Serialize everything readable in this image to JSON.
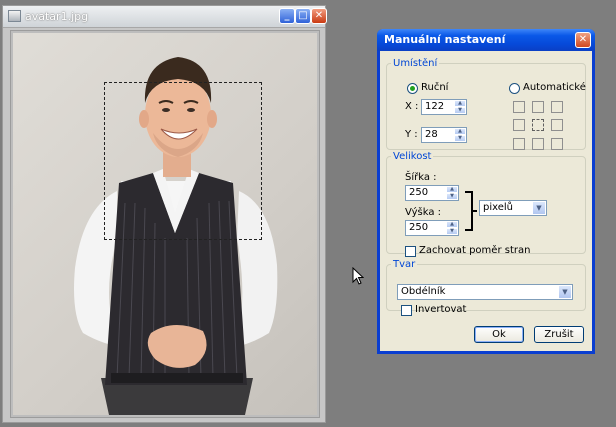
{
  "image_window": {
    "title": "avatar1.jpg",
    "minimize_glyph": "_",
    "maximize_glyph": "□",
    "close_glyph": "✕",
    "photo_alt": "Portrait photo of a smiling man in a white shirt and black vest"
  },
  "dialog": {
    "title": "Manuální nastavení",
    "close_glyph": "✕",
    "placement": {
      "legend": "Umístění",
      "manual_label": "Ruční",
      "auto_label": "Automatické",
      "x_label": "X :",
      "x_value": "122",
      "y_label": "Y :",
      "y_value": "28",
      "manual_selected": true
    },
    "size": {
      "legend": "Velikost",
      "width_label": "Šířka :",
      "width_value": "250",
      "height_label": "Výška :",
      "height_value": "250",
      "unit_value": "pixelů",
      "keep_ratio_label": "Zachovat poměr stran",
      "keep_ratio_checked": false
    },
    "shape": {
      "legend": "Tvar",
      "shape_value": "Obdélník",
      "invert_label": "Invertovat",
      "invert_checked": false
    },
    "ok_label": "Ok",
    "cancel_label": "Zrušit"
  },
  "colors": {
    "desktop": "#7e7e7e",
    "dialog_face": "#ece9d8",
    "xp_blue": "#0a58e8",
    "group_legend": "#0046d5"
  }
}
